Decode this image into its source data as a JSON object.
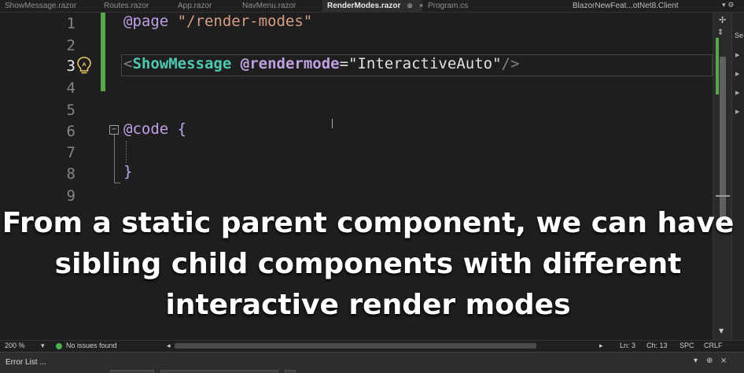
{
  "tabs": [
    {
      "label": "ShowMessage.razor",
      "active": false
    },
    {
      "label": "Routes.razor",
      "active": false
    },
    {
      "label": "App.razor",
      "active": false
    },
    {
      "label": "NavMenu.razor",
      "active": false
    },
    {
      "label": "RenderModes.razor",
      "active": true
    },
    {
      "label": "Program.cs",
      "active": false
    }
  ],
  "active_tab_pin": "⊕",
  "active_tab_close": "×",
  "solution_name": "BlazorNewFeat...otNet8.Client",
  "tab_dropdown": "▾ ⚙",
  "side_panel_label": "Se",
  "line_numbers": [
    "1",
    "2",
    "3",
    "4",
    "5",
    "6",
    "7",
    "8",
    "9"
  ],
  "current_line": 3,
  "code": {
    "line1_directive": "@page",
    "line1_route": "\"/render-modes\"",
    "line3_open": "<",
    "line3_component": "ShowMessage",
    "line3_attr": "@rendermode",
    "line3_eq": "=",
    "line3_value": "\"InteractiveAuto\"",
    "line3_close": "/>",
    "line6_directive": "@code",
    "line6_brace": "{",
    "line8_brace": "}"
  },
  "fold_glyph": "−",
  "caption": [
    "From a static parent component, we can have",
    "sibling child components with different",
    "interactive render modes"
  ],
  "status": {
    "zoom": "200 %",
    "issues": "No issues found",
    "line": "Ln: 3",
    "col": "Ch: 13",
    "spc": "SPC",
    "eol": "CRLF"
  },
  "bottom_panel": {
    "title": "Error List ...",
    "controls": [
      "▾",
      "⊕",
      "×"
    ]
  },
  "colors": {
    "change_bar": "#57a64a",
    "component": "#4ec9b0",
    "string": "#d69d85",
    "directive": "#c0a0e6"
  }
}
